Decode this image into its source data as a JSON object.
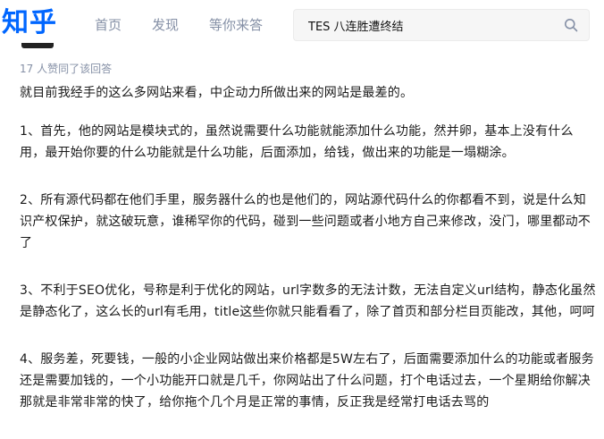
{
  "header": {
    "logo": "知乎",
    "nav": [
      "首页",
      "发现",
      "等你来答"
    ],
    "search_value": "TES 八连胜遭终结"
  },
  "answer": {
    "meta": "17 人赞同了该回答",
    "paragraphs": [
      "就目前我经手的这么多网站来看，中企动力所做出来的网站是最差的。",
      "1、首先，他的网站是模块式的，虽然说需要什么功能就能添加什么功能，然并卵，基本上没有什么用，最开始你要的什么功能就是什么功能，后面添加，给钱，做出来的功能是一塌糊涂。",
      "2、所有源代码都在他们手里，服务器什么的也是他们的，网站源代码什么的你都看不到，说是什么知识产权保护，就这破玩意，谁稀罕你的代码，碰到一些问题或者小地方自己来修改，没门，哪里都动不了",
      "3、不利于SEO优化，号称是利于优化的网站，url字数多的无法计数，无法自定义url结构，静态化虽然是静态化了，这么长的url有毛用，title这些你就只能看看了，除了首页和部分栏目页能改，其他，呵呵",
      "4、服务差，死要钱，一般的小企业网站做出来价格都是5W左右了，后面需要添加什么的功能或者服务还是需要加钱的，一个小功能开口就是几千，你网站出了什么问题，打个电话过去，一个星期给你解决那就是非常非常的快了，给你拖个几个月是正常的事情，反正我是经常打电话去骂的"
    ]
  }
}
